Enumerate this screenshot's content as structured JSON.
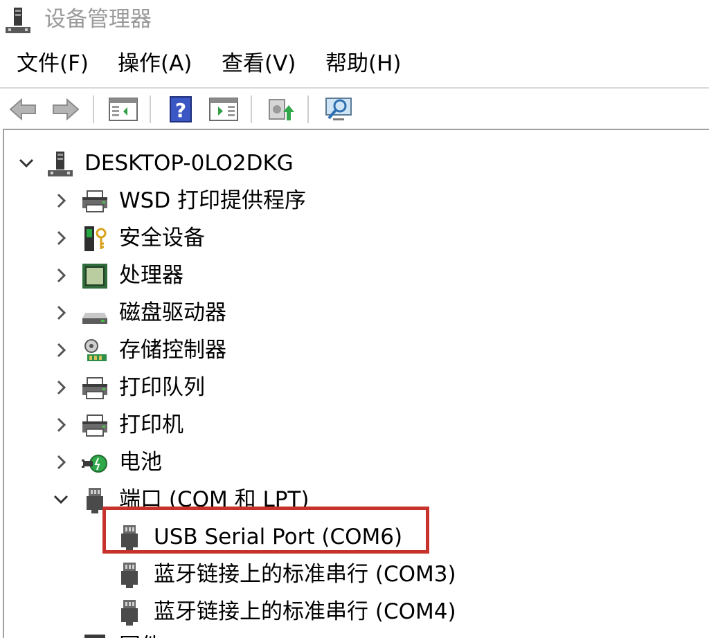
{
  "window": {
    "title": "设备管理器",
    "icon": "device-manager-icon"
  },
  "menu": [
    {
      "label": "文件(F)"
    },
    {
      "label": "操作(A)"
    },
    {
      "label": "查看(V)"
    },
    {
      "label": "帮助(H)"
    }
  ],
  "toolbar": [
    {
      "icon": "back-arrow-icon"
    },
    {
      "icon": "forward-arrow-icon"
    },
    {
      "icon": "show-hide-console-tree-icon"
    },
    {
      "icon": "help-icon"
    },
    {
      "icon": "run-panel-icon"
    },
    {
      "icon": "update-driver-icon"
    },
    {
      "icon": "scan-hardware-icon"
    }
  ],
  "tree": {
    "root": "DESKTOP-0LO2DKG",
    "categories": [
      {
        "label": "WSD 打印提供程序",
        "icon": "printer-icon",
        "expanded": false
      },
      {
        "label": "安全设备",
        "icon": "security-key-icon",
        "expanded": false
      },
      {
        "label": "处理器",
        "icon": "processor-chip-icon",
        "expanded": false
      },
      {
        "label": "磁盘驱动器",
        "icon": "disk-drive-icon",
        "expanded": false
      },
      {
        "label": "存储控制器",
        "icon": "storage-controller-icon",
        "expanded": false
      },
      {
        "label": "打印队列",
        "icon": "printer-icon",
        "expanded": false
      },
      {
        "label": "打印机",
        "icon": "printer-icon",
        "expanded": false
      },
      {
        "label": "电池",
        "icon": "battery-plug-icon",
        "expanded": false
      },
      {
        "label": "端口 (COM 和 LPT)",
        "icon": "port-connector-icon",
        "expanded": true
      }
    ],
    "ports": [
      {
        "label": "USB Serial Port (COM6)",
        "icon": "port-connector-icon",
        "highlighted": true
      },
      {
        "label": "蓝牙链接上的标准串行 (COM3)",
        "icon": "port-connector-icon"
      },
      {
        "label": "蓝牙链接上的标准串行 (COM4)",
        "icon": "port-connector-icon"
      }
    ],
    "partial_next": "固件"
  },
  "colors": {
    "highlight_border": "#c8322c",
    "title_text": "#9a9a9a"
  }
}
